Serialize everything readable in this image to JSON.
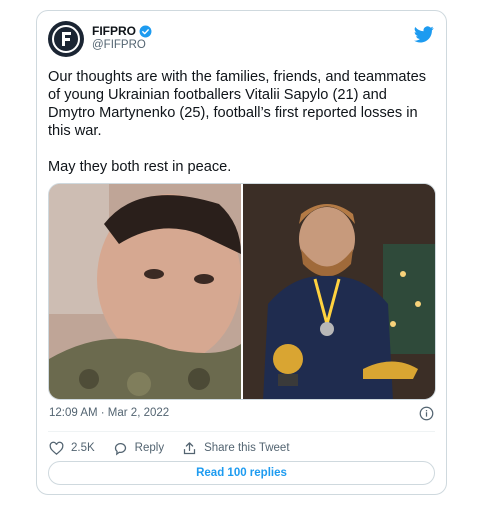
{
  "tweet": {
    "author": {
      "display_name": "FIFPRO",
      "handle": "@FIFPRO",
      "verified": true,
      "avatar_icon": "fifpro-logo-icon"
    },
    "platform_icon": "twitter-bird-icon",
    "text": "Our thoughts are with the families, friends, and teammates of young Ukrainian footballers Vitalii Sapylo (21) and Dmytro Martynenko (25), football’s first reported losses in this war.\n\nMay they both rest in peace.",
    "timestamp": "12:09 AM · Mar 2, 2022",
    "actions": {
      "like_count": "2.5K",
      "reply_label": "Reply",
      "share_label": "Share this Tweet"
    },
    "read_replies_label": "Read 100 replies"
  },
  "colors": {
    "accent": "#1d9bf0",
    "secondary_text": "#536471",
    "border": "#cfd9de"
  }
}
